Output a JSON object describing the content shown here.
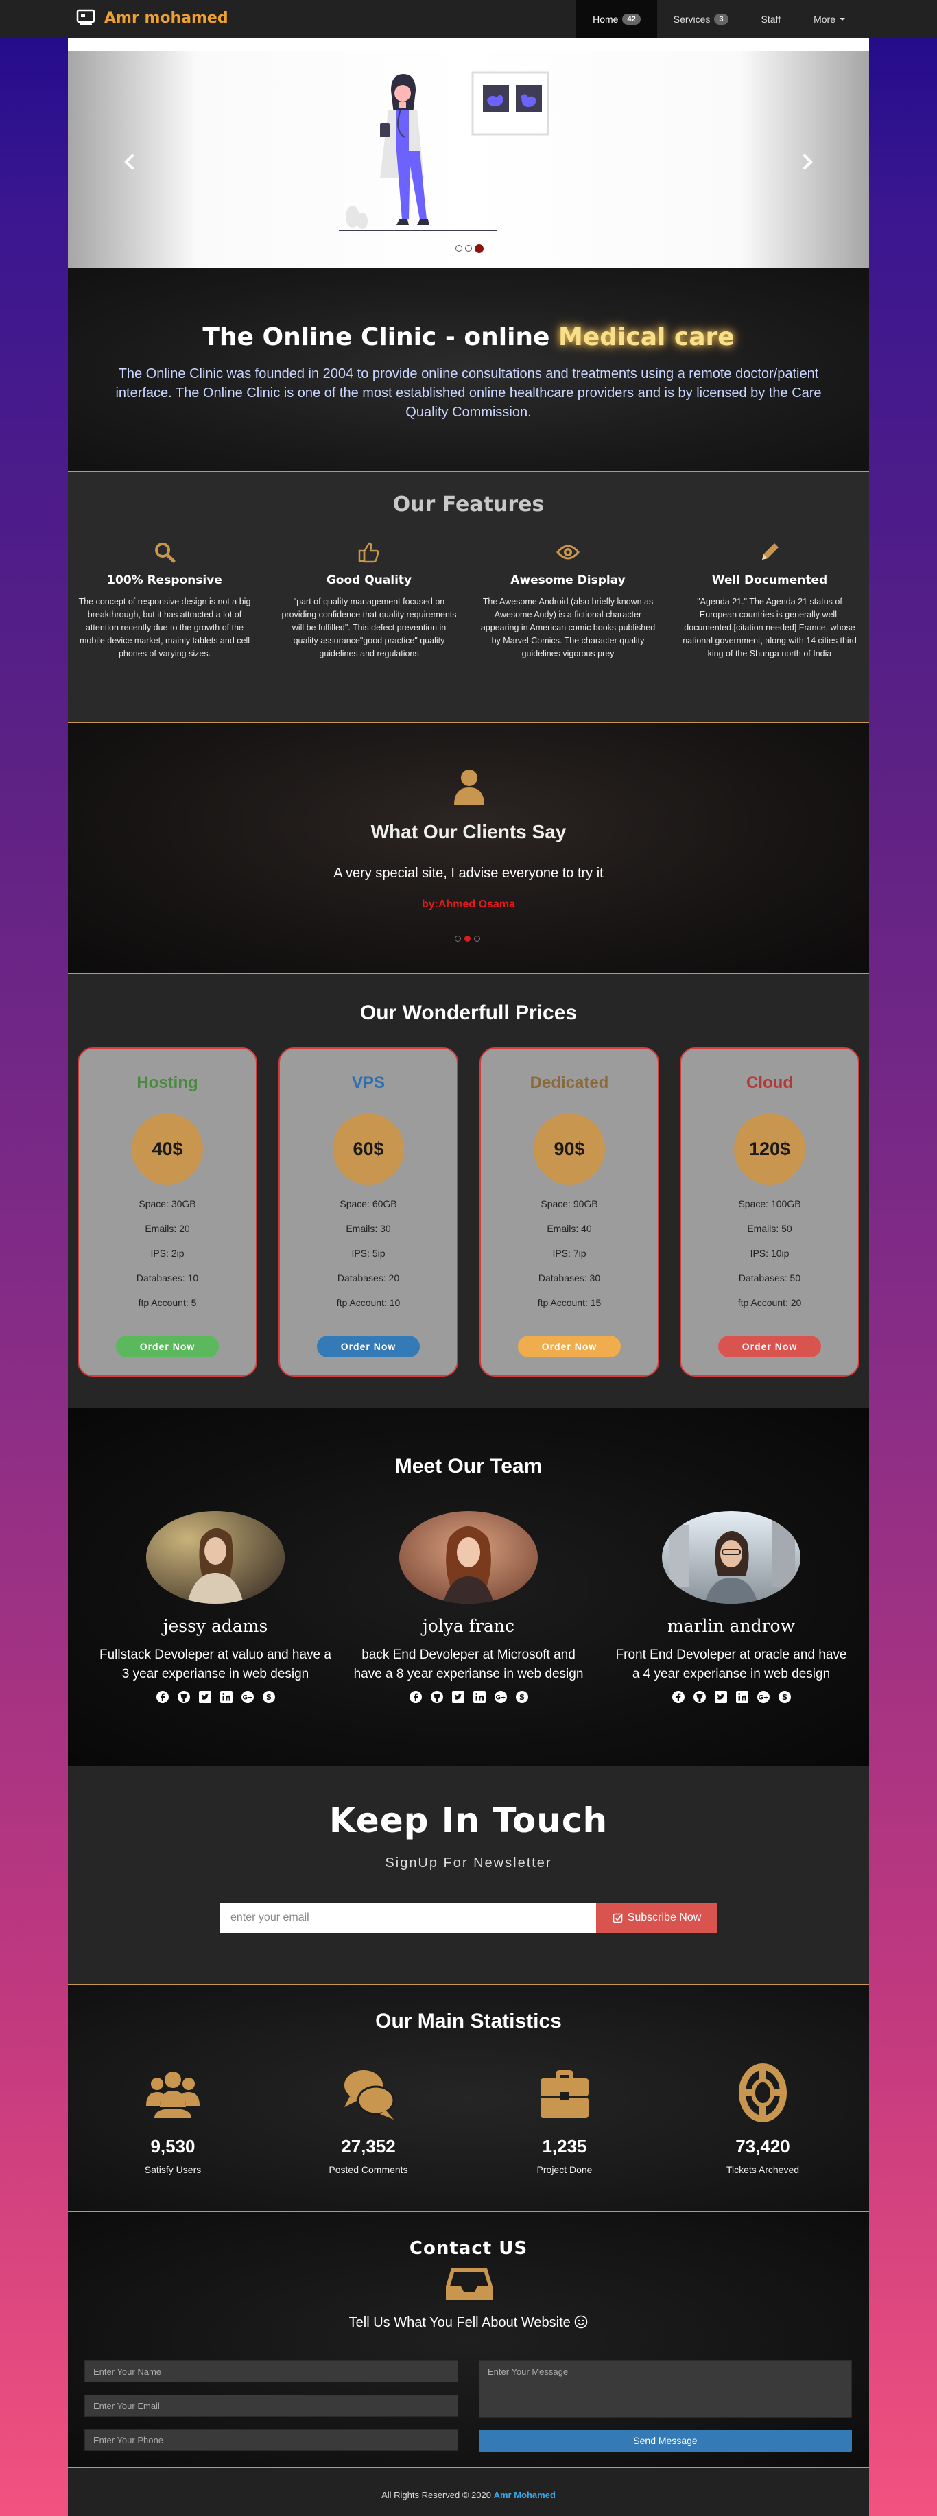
{
  "navbar": {
    "brand": "Amr mohamed",
    "brand_icon": "screen-icon",
    "items": [
      {
        "label": "Home",
        "badge": "42",
        "active": true
      },
      {
        "label": "Services",
        "badge": "3",
        "active": false
      },
      {
        "label": "Staff",
        "active": false
      },
      {
        "label": "More",
        "dropdown": true,
        "active": false
      }
    ]
  },
  "carousel": {
    "indicator_count": 3,
    "active_index": 2
  },
  "hero": {
    "title_prefix": "The Online Clinic - online ",
    "title_highlight": "Medical care",
    "text": "The Online Clinic was founded in 2004 to provide online consultations and treatments using a remote doctor/patient interface. The Online Clinic is one of the most established online healthcare providers and is by licensed by the Care Quality Commission."
  },
  "features": {
    "title": "Our Features",
    "items": [
      {
        "icon": "search-icon",
        "title": "100% Responsive",
        "text": "The concept of responsive design is not a big breakthrough, but it has attracted a lot of attention recently due to the growth of the mobile device market, mainly tablets and cell phones of varying sizes."
      },
      {
        "icon": "thumbs-up-icon",
        "title": "Good Quality",
        "text": "\"part of quality management focused on providing confidence that quality requirements will be fulfilled\". This defect prevention in quality assurance\"good practice\" quality guidelines and regulations"
      },
      {
        "icon": "eye-icon",
        "title": "Awesome Display",
        "text": "The Awesome Android (also briefly known as Awesome Andy) is a fictional character appearing in American comic books published by Marvel Comics. The character quality guidelines vigorous prey"
      },
      {
        "icon": "pencil-icon",
        "title": "Well Documented",
        "text": "\"Agenda 21.\" The Agenda 21 status of European countries is generally well-documented.[citation needed] France, whose national government, along with 14 cities third king of the Shunga north of India"
      }
    ]
  },
  "testimonial": {
    "title": "What Our Clients Say",
    "quote": "A very special site, I advise everyone to try it",
    "author": "by:Ahmed Osama",
    "dot_count": 3,
    "active_index": 1
  },
  "prices": {
    "title": "Our Wonderfull Prices",
    "plans": [
      {
        "name": "Hosting",
        "color": "#4a8a3f",
        "price": "40$",
        "rows": [
          "Space: 30GB",
          "Emails: 20",
          "IPS: 2ip",
          "Databases: 10",
          "ftp Account: 5"
        ],
        "button": "Order Now",
        "button_color": "#5cb85c"
      },
      {
        "name": "VPS",
        "color": "#2f6fb0",
        "price": "60$",
        "rows": [
          "Space: 60GB",
          "Emails: 30",
          "IPS: 5ip",
          "Databases: 20",
          "ftp Account: 10"
        ],
        "button": "Order Now",
        "button_color": "#337ab7"
      },
      {
        "name": "Dedicated",
        "color": "#8a6a3c",
        "price": "90$",
        "rows": [
          "Space: 90GB",
          "Emails: 40",
          "IPS: 7ip",
          "Databases: 30",
          "ftp Account: 15"
        ],
        "button": "Order Now",
        "button_color": "#f0ad4e"
      },
      {
        "name": "Cloud",
        "color": "#b03a3a",
        "price": "120$",
        "rows": [
          "Space: 100GB",
          "Emails: 50",
          "IPS: 10ip",
          "Databases: 50",
          "ftp Account: 20"
        ],
        "button": "Order Now",
        "button_color": "#d9534f"
      }
    ]
  },
  "team": {
    "title": "Meet Our Team",
    "members": [
      {
        "name": "jessy adams",
        "bio": "Fullstack Devoleper at valuo and have a 3 year experianse in web design"
      },
      {
        "name": "jolya franc",
        "bio": "back End Devoleper at Microsoft and have a 8 year experianse in web design"
      },
      {
        "name": "marlin androw",
        "bio": "Front End Devoleper at oracle and have a 4 year experianse in web design"
      }
    ],
    "social_icons": [
      "facebook-icon",
      "github-icon",
      "twitter-icon",
      "linkedin-icon",
      "google-plus-icon",
      "skype-icon"
    ]
  },
  "newsletter": {
    "title": "Keep In Touch",
    "subtitle": "SignUp For Newsletter",
    "placeholder": "enter your email",
    "button": "Subscribe Now"
  },
  "stats": {
    "title": "Our Main Statistics",
    "items": [
      {
        "icon": "users-icon",
        "number": "9,530",
        "label": "Satisfy Users"
      },
      {
        "icon": "comments-icon",
        "number": "27,352",
        "label": "Posted Comments"
      },
      {
        "icon": "briefcase-icon",
        "number": "1,235",
        "label": "Project Done"
      },
      {
        "icon": "life-ring-icon",
        "number": "73,420",
        "label": "Tickets Archeved"
      }
    ]
  },
  "contact": {
    "title": "Contact US",
    "subtitle": "Tell Us What You Fell About Website",
    "name_placeholder": "Enter Your Name",
    "email_placeholder": "Enter Your Email",
    "phone_placeholder": "Enter Your Phone",
    "message_placeholder": "Enter Your Message",
    "send_button": "Send Message"
  },
  "footer": {
    "text": "All Rights Reserved © 2020 ",
    "brand": "Amr Mohamed"
  },
  "colors": {
    "accent": "#c9964f",
    "brand": "#f0a030",
    "author": "#e01b1b"
  }
}
